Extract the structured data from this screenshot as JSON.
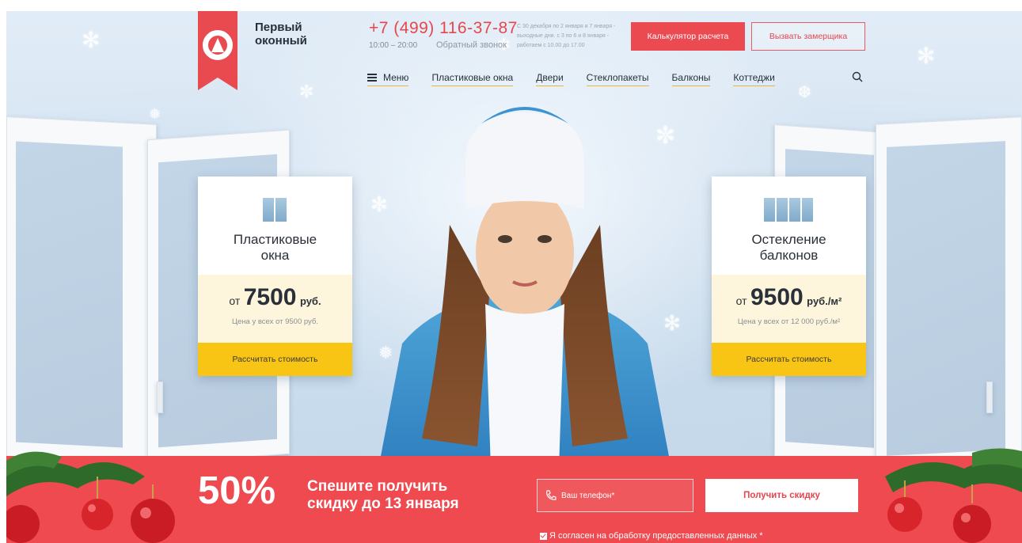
{
  "brand": {
    "line1": "Первый",
    "line2": "оконный"
  },
  "contact": {
    "phone": "+7 (499) 116-37-87",
    "hours": "10:00 – 20:00",
    "callback": "Обратный звонок",
    "holiday_note": "С 30 декабря по 2 января и 7 января - выходные дни. с 3 по 6 и 8 января - работаем с 10.00 до 17.00"
  },
  "header_buttons": {
    "calc": "Калькулятор расчета",
    "measure": "Вызвать замерщика"
  },
  "nav": {
    "menu": "Меню",
    "items": [
      "Пластиковые окна",
      "Двери",
      "Стеклопакеты",
      "Балконы",
      "Коттеджи"
    ]
  },
  "cards": [
    {
      "title1": "Пластиковые",
      "title2": "окна",
      "from": "от",
      "price": "7500",
      "unit": "руб.",
      "compare": "Цена у всех от 9500 руб.",
      "cta": "Рассчитать стоимость"
    },
    {
      "title1": "Остекление",
      "title2": "балконов",
      "from": "от",
      "price": "9500",
      "unit": "руб./м²",
      "compare": "Цена у всех от 12 000 руб./м²",
      "cta": "Рассчитать стоимость"
    }
  ],
  "promo": {
    "percent": "50%",
    "headline1": "Спешите получить",
    "headline2": "скидку до 13 января",
    "phone_placeholder": "Ваш телефон*",
    "button": "Получить скидку",
    "consent": "Я согласен на обработку предоставленных данных *"
  },
  "colors": {
    "accent_red": "#ee4a4f",
    "cta_yellow": "#f8c515",
    "price_bg": "#fdf6dd"
  }
}
